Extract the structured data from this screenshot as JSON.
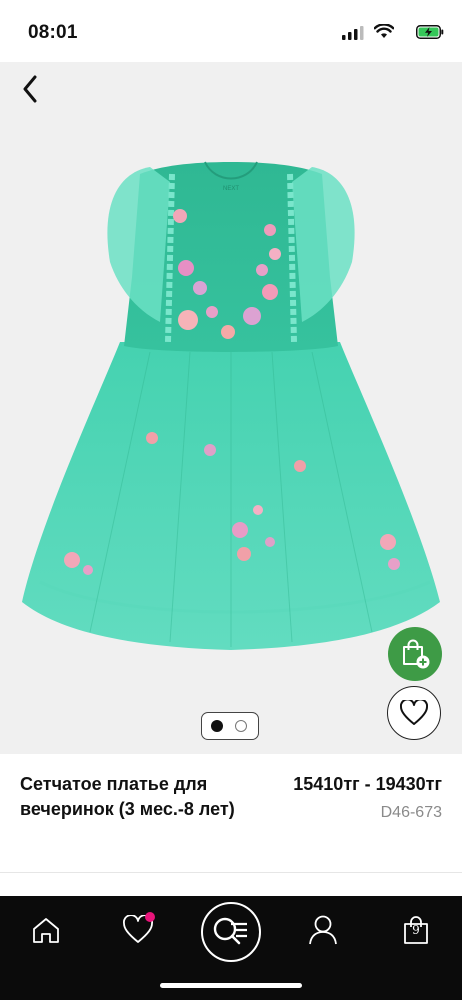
{
  "status_bar": {
    "time": "08:01",
    "icons": [
      "signal-icon",
      "wifi-icon",
      "battery-charging-icon"
    ]
  },
  "gallery": {
    "current_slide": 1,
    "total_slides": 2,
    "image_alt": "mint green tulle party dress with embroidered flowers",
    "garment_label": "NEXT"
  },
  "product": {
    "title": "Сетчатое платье для вечеринок (3 мес.-8 лет)",
    "price": "15410тг - 19430тг",
    "code": "D46-673"
  },
  "partial_next_section": "",
  "bottom_nav": {
    "items": [
      "home-icon",
      "favourites-icon",
      "search-icon",
      "account-icon",
      "bag-icon"
    ],
    "bag_count": "9",
    "fav_dot_color": "#e8147a"
  },
  "colors": {
    "add_to_bag_green": "#3e9b46",
    "nav_background": "#0b0b0b",
    "image_background": "#f0f0f0",
    "dress_mint": "#3cc9a6"
  }
}
